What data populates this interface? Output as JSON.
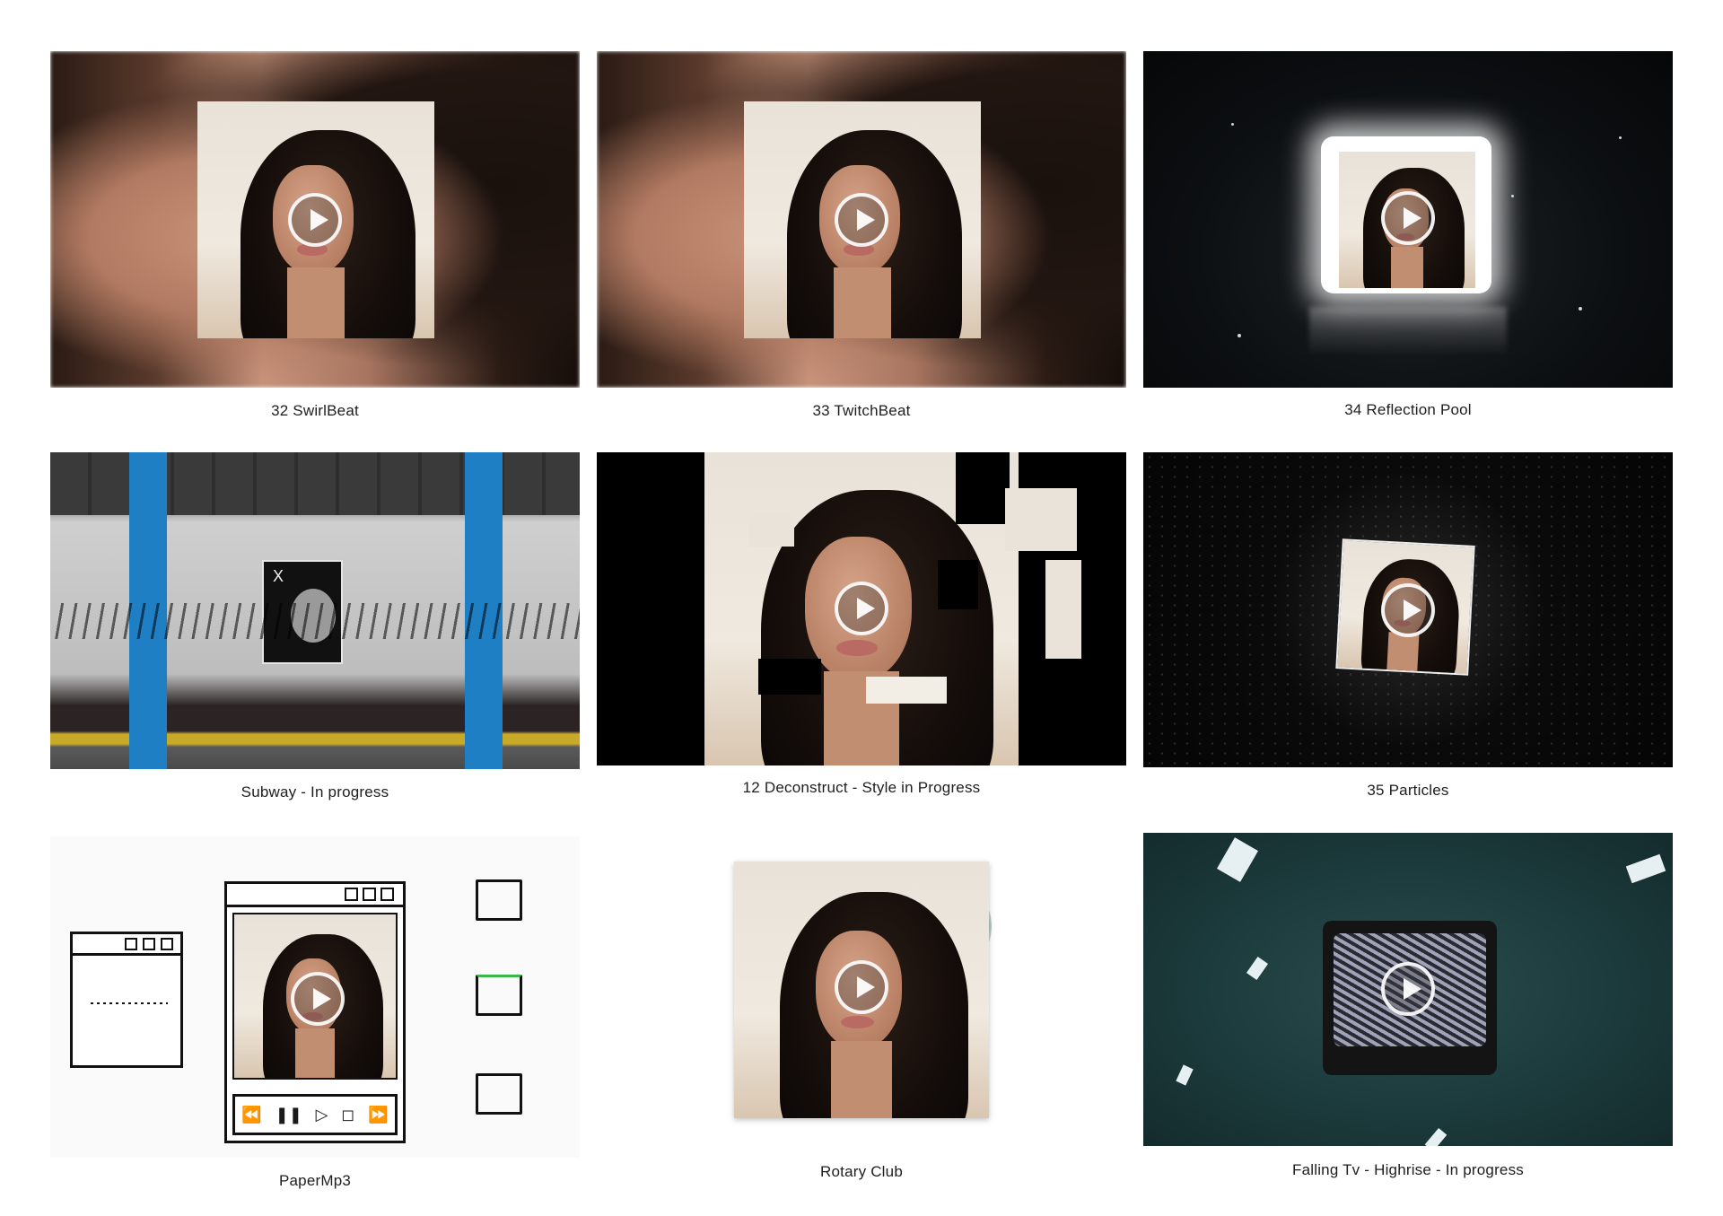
{
  "gallery": {
    "items": [
      {
        "caption": "32 SwirlBeat"
      },
      {
        "caption": "33 TwitchBeat"
      },
      {
        "caption": "34 Reflection Pool"
      },
      {
        "caption": "Subway - In progress"
      },
      {
        "caption": "12 Deconstruct - Style in Progress"
      },
      {
        "caption": "35 Particles"
      },
      {
        "caption": "PaperMp3"
      },
      {
        "caption": "Rotary Club"
      },
      {
        "caption": "Falling Tv - Highrise - In progress"
      }
    ]
  },
  "icons": {
    "play": "play-icon",
    "window_controls": [
      "minimize-icon",
      "maximize-icon",
      "close-icon"
    ],
    "player_controls": [
      "rewind-icon",
      "pause-icon",
      "play-icon",
      "stop-icon",
      "fast-forward-icon"
    ],
    "folder": "folder-icon",
    "graffiti_text": "X"
  },
  "colors": {
    "subway_pillar": "#1f7fc4",
    "subway_stripe": "#d7b52a",
    "particles_bg": "#0a0a0a",
    "falling_tv_bg": "#1c3b3c"
  }
}
